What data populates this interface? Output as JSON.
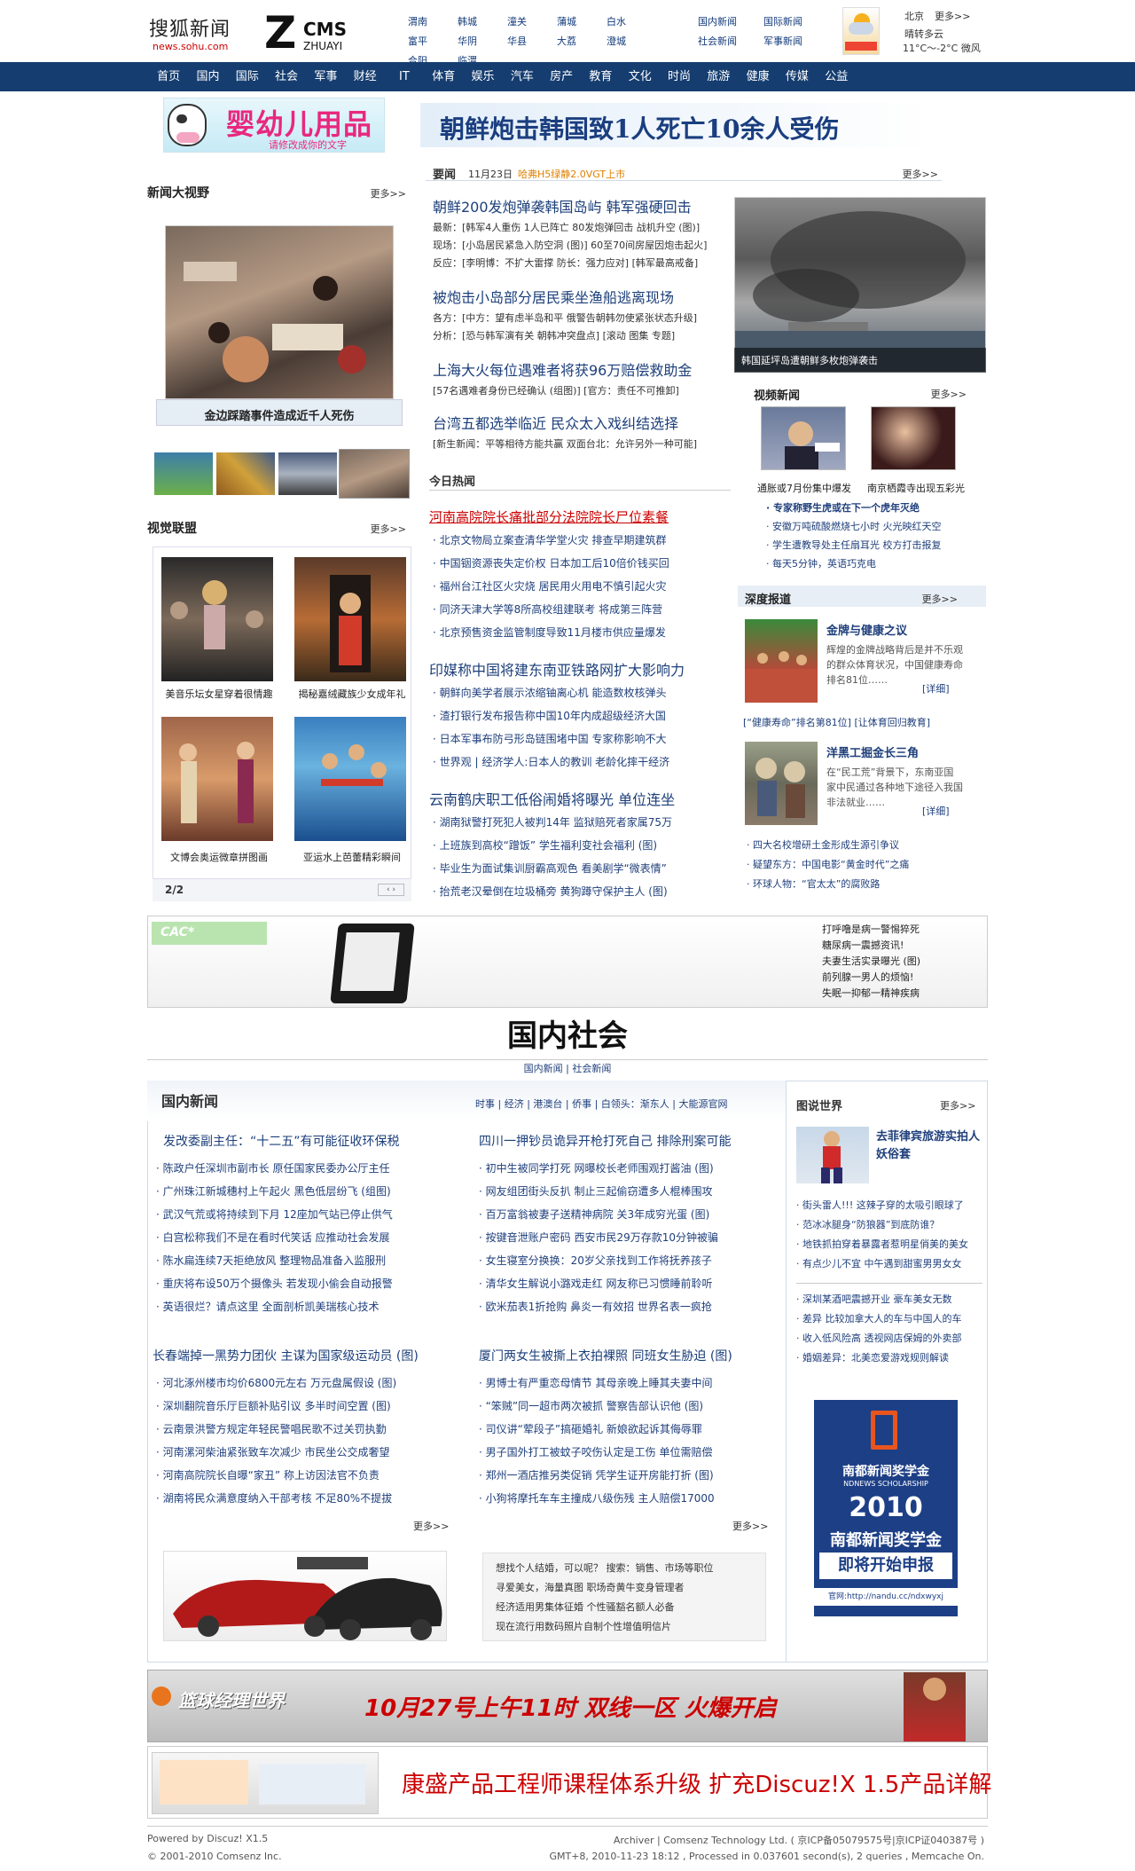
{
  "header": {
    "site_name": "搜狐新闻",
    "site_url": "news.sohu.com",
    "cms_logo": "ZCMS ZHUAYI",
    "cities": [
      "渭南",
      "韩城",
      "潼关",
      "蒲城",
      "白水",
      "富平",
      "华阴",
      "华县",
      "大荔",
      "澄城",
      "合阳",
      "临渭"
    ],
    "toplinks": [
      "国内新闻",
      "国际新闻",
      "社会新闻",
      "军事新闻"
    ],
    "weather": {
      "city": "北京",
      "more": "更多>>",
      "cond": "晴转多云",
      "temp": "11°C～-2°C 微风"
    }
  },
  "nav": [
    "首页",
    "国内",
    "国际",
    "社会",
    "军事",
    "财经",
    "IT",
    "体育",
    "娱乐",
    "汽车",
    "房产",
    "教育",
    "文化",
    "时尚",
    "旅游",
    "健康",
    "传媒",
    "公益"
  ],
  "ad_top": {
    "title": "婴幼儿用品",
    "sub": "请修改成你的文字"
  },
  "headline": "朝鲜炮击韩国致1人死亡10余人受伤",
  "news_vision": {
    "title": "新闻大视野",
    "more": "更多>>",
    "caption": "金边踩踏事件造成近千人死伤"
  },
  "visual": {
    "title": "视觉联盟",
    "more": "更多>>",
    "items": [
      "美音乐坛女星穿着很情趣",
      "揭秘嘉绒藏族少女成年礼",
      "文博会奥运微章拼图画",
      "亚运水上芭蕾精彩瞬间"
    ],
    "pager": "2/2"
  },
  "important": {
    "title": "要闻",
    "date": "11月23日",
    "promo": "哈弗H5绿静2.0VGT上市",
    "more": "更多>>",
    "h1": "朝鲜200发炮弹袭韩国岛屿 韩军强硬回击",
    "s1": [
      "最新：[韩军4人重伤 1人已阵亡 80发炮弹回击 战机升空 (图)]",
      "现场：[小岛居民紧急入防空洞 (图)] 60至70间房屋因炮击起火]",
      "反应：[李明博：不扩大雷撑 防长：强力应对] [韩军最高戒备]"
    ],
    "h2": "被炮击小岛部分居民乘坐渔船逃离现场",
    "s2": [
      "各方：[中方：望有虑半岛和平 俄警告朝韩勿使紧张状态升级]",
      "分析：[恐与韩军演有关 朝韩冲突盘点] [滚动 图集 专题]"
    ],
    "h3": "上海大火每位遇难者将获96万赔偿救助金",
    "s3": [
      "[57名遇难者身份已经确认 (组图)] [官方：责任不可推卸]"
    ],
    "h4": "台湾五都选举临近 民众太入戏纠结选择",
    "s4": [
      "[新生新闻：平等相待方能共赢 双面台北：允许另外一种可能]"
    ]
  },
  "hot": {
    "title": "今日热闻",
    "top": "河南高院院长痛批部分法院院长尸位素餐",
    "list1": [
      "北京文物局立案查清华学堂火灾 排查早期建筑群",
      "中国铟资源丧失定价权 日本加工后10倍价钱买回",
      "福州台江社区火灾烧 居民用火用电不慎引起火灾",
      "同济天津大学等8所高校组建联考 将成第三阵营",
      "北京预售资金监管制度导致11月楼市供应量爆发"
    ],
    "h2": "印媒称中国将建东南亚铁路网扩大影响力",
    "list2": [
      "朝鲜向美学者展示浓缩铀离心机 能造数枚核弹头",
      "渣打银行发布报告称中国10年内成超级经济大国",
      "日本军事布防弓形岛链围堵中国 专家称影响不大",
      "世界观 | 经济学人:日本人的教训 老龄化摔干经济"
    ],
    "h3": "云南鹤庆职工低俗闹婚将曝光 单位连坐",
    "list3": [
      "湖南狱警打死犯人被判14年 监狱赔死者家属75万",
      "上班族到高校“蹭饭” 学生福利变社会福利 (图)",
      "毕业生为面试集训厨霸高观色 看美剧学“微表情”",
      "抬荒老汉晕倒在垃圾桶旁 黄狗蹲守保护主人 (图)"
    ]
  },
  "lead_photo": {
    "caption": "韩国延坪岛遭朝鲜多枚炮弹袭击"
  },
  "video": {
    "title": "视频新闻",
    "more": "更多>>",
    "items": [
      "通胀或7月份集中爆发",
      "南京栖霞寺出现五彩光"
    ],
    "list": [
      "专家称野生虎或在下一个虎年灭绝",
      "安徽万吨硫酸燃烧七小时 火光映红天空",
      "学生遭教导处主任扇耳光 校方打击报复",
      "每天5分钟，英语巧克电"
    ]
  },
  "deep": {
    "title": "深度报道",
    "more": "更多>>",
    "a1": {
      "title": "金牌与健康之议",
      "text": "辉煌的金牌战略背后是并不乐观的群众体育状况，中国健康寿命排名81位……",
      "link": "[详细]"
    },
    "a1_links": "[“健康寿命”排名第81位] [让体育回归教育]",
    "a2": {
      "title": "洋黑工掘金长三角",
      "text": "在“民工荒”背景下，东南亚国家中民通过各种地下途径入我国非法就业……",
      "link": "[详细]"
    },
    "list": [
      "四大名校增研土金形成生源引争议",
      "疑望东方：中国电影“黄金时代”之痛",
      "环球人物：“官太太”的腐败路"
    ]
  },
  "ad_mid": {
    "brand": "CAC*",
    "links": [
      "打呼噜是病一警惕猝死",
      "糖尿病一震撼资讯!",
      "夫妻生活实录曝光 (图)",
      "前列腺一男人的烦恼!",
      "失眠一抑郁一精神疾病"
    ]
  },
  "section": {
    "title": "国内社会",
    "sub": "国内新闻 | 社会新闻"
  },
  "domestic": {
    "title": "国内新闻",
    "tabs": [
      "时事",
      "经济",
      "港澳台",
      "侨事",
      "白领头：渐东人",
      "大能源官网"
    ],
    "col1_head": "发改委副主任：“十二五”有可能征收环保税",
    "col1": [
      "陈政户任深圳市副市长 原任国家民委办公厅主任",
      "广州珠江新城穗村上午起火 黑色低层纷飞 (组图)",
      "武汉气荒或将持续到下月 12座加气站已停止供气",
      "白宫松称我们不是在看时代笑话 应推动社会发展",
      "陈水扁连续7天拒绝放风 整理物品准备入监服刑",
      "重庆将布设50万个摄像头 若发现小偷会自动报警",
      "英语很烂？请点这里  全面剖析凯美瑞核心技术"
    ],
    "col1_head2": "长春端掉一黑势力团伙 主谋为国家级运动员 (图)",
    "col1b": [
      "河北涿州楼市均价6800元左右 万元盘属假设 (图)",
      "深圳翻院音乐厅巨额补贴引议 多半时间空置 (图)",
      "云南景洪警方规定年轻民警唱民歌不过关罚执勤",
      "河南漯河柴油紧张致车次减少 市民坐公交成奢望",
      "河南高院院长自曝“家丑” 称上访因法官不负责",
      "湖南将民众满意度纳入干部考核 不足80%不提拔"
    ],
    "col2_head": "四川一押钞员诡异开枪打死自己 排除刑案可能",
    "col2": [
      "初中生被同学打死 网曝校长老师围观打酱油 (图)",
      "网友组团街头反扒 制止三起偷窃遭多人棍棒围攻",
      "百万富翁被妻子送精神病院 关3年成穷光蛋 (图)",
      "按键音泄账户密码 西安市民29万存款10分钟被骗",
      "女生寝室分换换：20岁父亲找到工作将抚养孩子",
      "清华女生解说小潞戏走红 网友称已习惯睡前聆听",
      "欧米茄表1折抢购  鼻炎一有效招  世界名表一疯抢"
    ],
    "col2_head2": "厦门两女生被撕上衣拍裸照 同班女生胁迫 (图)",
    "col2b": [
      "男博士有严重恋母情节 其母亲晚上睡其夫妻中间",
      "“笨贼”同一超市两次被抓 警察告部认识他 (图)",
      "司仪讲“荤段子”搞砸婚礼 新娘欲起诉其侮辱罪",
      "男子国外打工被蚊子咬伤认定是工伤 单位需赔偿",
      "郑州一酒店推另类促销 凭学生证开房能打折 (图)",
      "小狗将摩托车车主撞成八级伤残 主人赔偿17000"
    ],
    "more": "更多>>",
    "ads": [
      "想找个人结婚，可以呢？ 搜索：销售、市场等职位",
      "寻爱美女，海量真图 职场奇黄牛变身管理者",
      "经济适用男集体征婚 个性骚豁名额人必备",
      "现在流行用数码照片自制个性增值明信片"
    ]
  },
  "picworld": {
    "title": "图说世界",
    "more": "更多>>",
    "feature": "去菲律宾旅游实拍人妖俗套",
    "list1": [
      "街头雷人!!! 这辣子穿的太吸引眼球了",
      "范冰冰腿身“防狼器”到底防谁？",
      "地铁抓拍穿着暴露者惹明星俏美的美女",
      "有点少儿不宜 中午遇到甜蜜男男女女"
    ],
    "list2": [
      "深圳某酒吧震撼开业 豪车美女无数",
      "差异 比较加拿大人的车与中国人的车",
      "收入低风险高 透视网店保姆的外卖部",
      "婚姻差异：北美恋爱游戏规则解读"
    ],
    "nandu": {
      "title": "南都新闻奖学金",
      "sub": "NDNEWS SCHOLARSHIP",
      "year": "2010",
      "line1": "南都新闻奖学金",
      "line2": "即将开始申报",
      "url": "官网:http://nandu.cc/ndxwyxj"
    }
  },
  "banners": {
    "b1": {
      "left": "篮球经理世界",
      "mid": "10月27号上午11时 双线一区 火爆开启"
    },
    "b2": {
      "text": "康盛产品工程师课程体系升级 扩充Discuz!X 1.5产品详解"
    }
  },
  "footer": {
    "powered": "Powered by Discuz! X1.5",
    "copy": "© 2001-2010 Comsenz Inc.",
    "right1": "Archiver | Comsenz Technology Ltd. ( 京ICP备05079575号|京ICP证040387号 )",
    "right2": "GMT+8, 2010-11-23 18:12 , Processed in 0.037601 second(s), 2 queries , Memcache On."
  },
  "colors": {
    "nav": "#153d70",
    "link": "#1f3f7b",
    "red": "#c00"
  }
}
